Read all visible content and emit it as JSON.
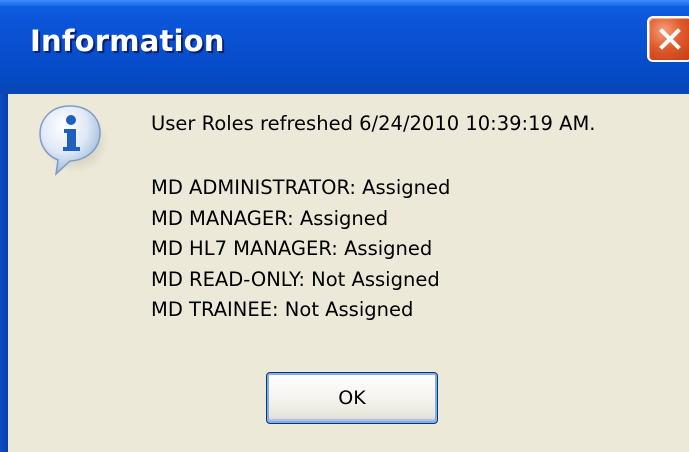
{
  "window": {
    "title": "Information",
    "close_icon": "close-icon"
  },
  "dialog": {
    "icon": "information-icon",
    "message": "User Roles refreshed 6/24/2010 10:39:19 AM.",
    "roles": [
      "MD ADMINISTRATOR: Assigned",
      "MD MANAGER: Assigned",
      "MD HL7 MANAGER: Assigned",
      "MD READ-ONLY: Not Assigned",
      "MD TRAINEE: Not Assigned"
    ],
    "ok_label": "OK"
  },
  "colors": {
    "titlebar": "#0850d0",
    "client_background": "#ece9d8",
    "close_button": "#e05a2c",
    "button_focus_border": "#8aaae5"
  }
}
